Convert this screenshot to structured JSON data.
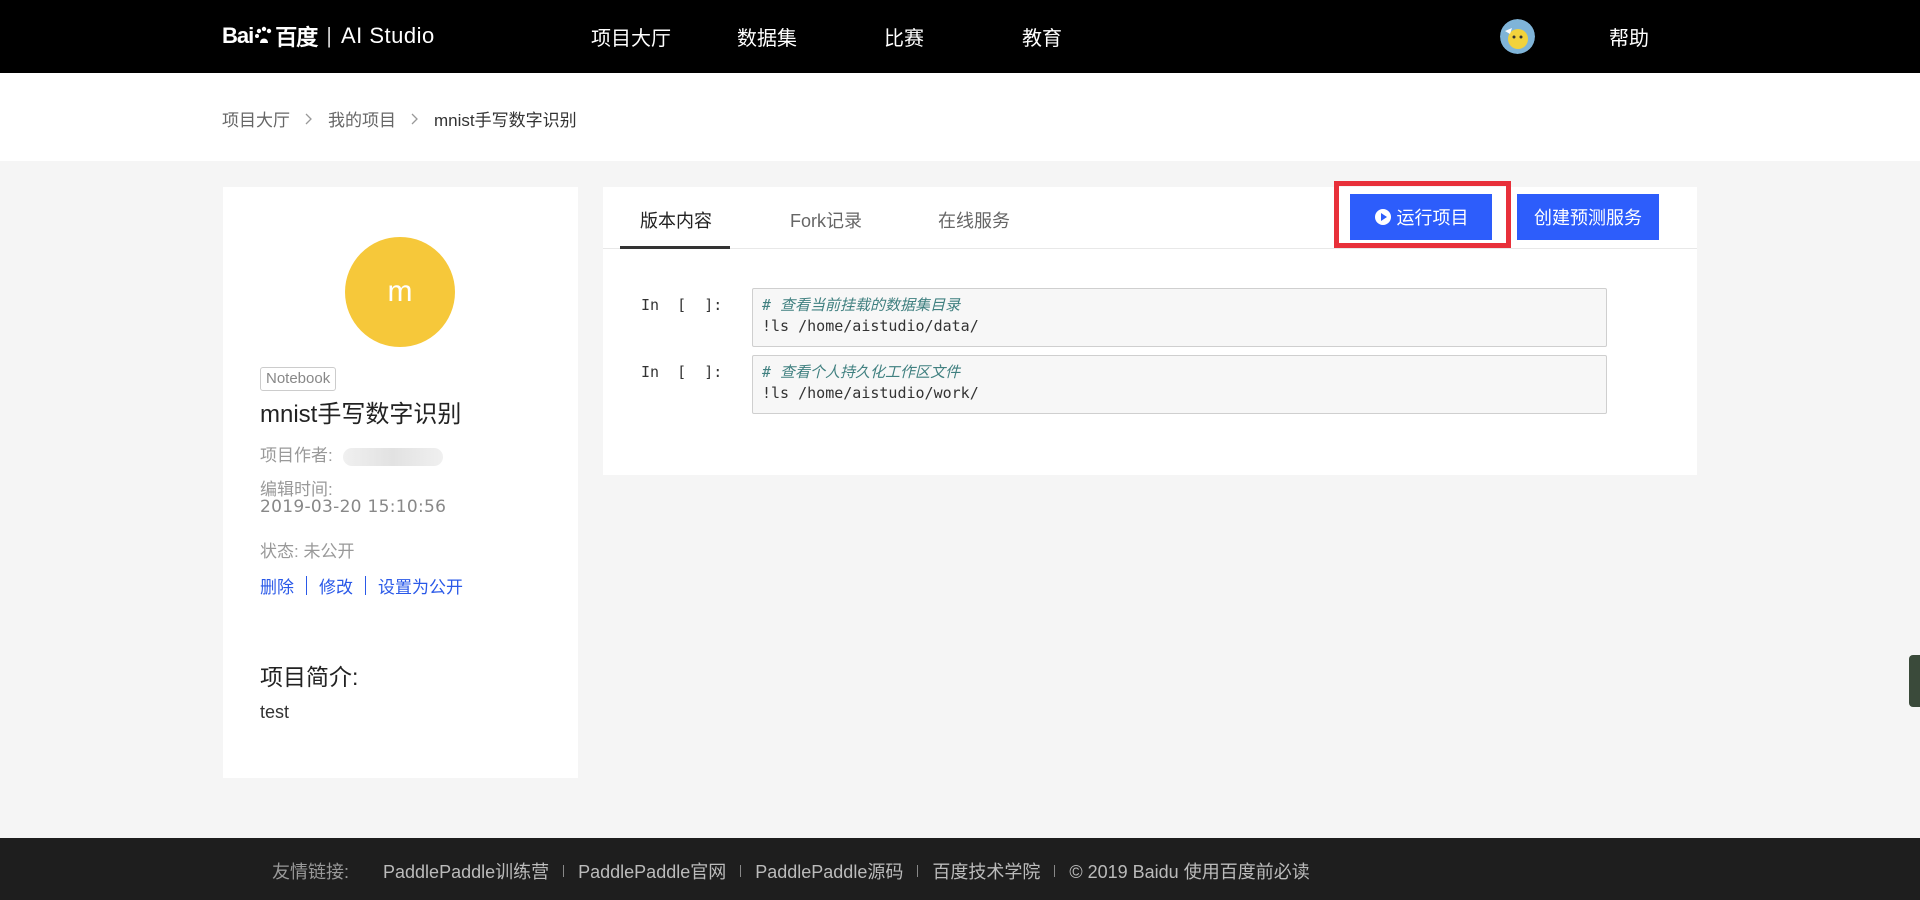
{
  "topnav": {
    "logo_baidu": "Bai",
    "logo_du": "百度",
    "logo_product": "AI Studio",
    "links": [
      "项目大厅",
      "数据集",
      "比赛",
      "教育"
    ],
    "help": "帮助"
  },
  "breadcrumb": {
    "items": [
      "项目大厅",
      "我的项目",
      "mnist手写数字识别"
    ]
  },
  "project": {
    "avatar_letter": "m",
    "type_tag": "Notebook",
    "title": "mnist手写数字识别",
    "author_label": "项目作者:",
    "edit_time_label": "编辑时间:",
    "edit_time": "2019-03-20 15:10:56",
    "status_label": "状态:",
    "status_value": "未公开",
    "actions": [
      "删除",
      "修改",
      "设置为公开"
    ],
    "intro_heading": "项目简介:",
    "intro_text": "test"
  },
  "tabs": {
    "items": [
      "版本内容",
      "Fork记录",
      "在线服务"
    ],
    "active": "版本内容"
  },
  "buttons": {
    "run_project": "运行项目",
    "create_service": "创建预测服务"
  },
  "notebook": {
    "cells": [
      {
        "prompt": "In  [  ]:",
        "comment": "# 查看当前挂载的数据集目录",
        "code": "!ls /home/aistudio/data/"
      },
      {
        "prompt": "In  [  ]:",
        "comment": "# 查看个人持久化工作区文件",
        "code": "!ls /home/aistudio/work/"
      }
    ]
  },
  "footer": {
    "label": "友情链接:",
    "links": [
      "PaddlePaddle训练营",
      "PaddlePaddle官网",
      "PaddlePaddle源码",
      "百度技术学院"
    ],
    "copyright": "© 2019 Baidu 使用百度前必读"
  },
  "colors": {
    "accent": "#2d5dfb",
    "highlight": "#e8303a",
    "avatar": "#f6c83a"
  }
}
